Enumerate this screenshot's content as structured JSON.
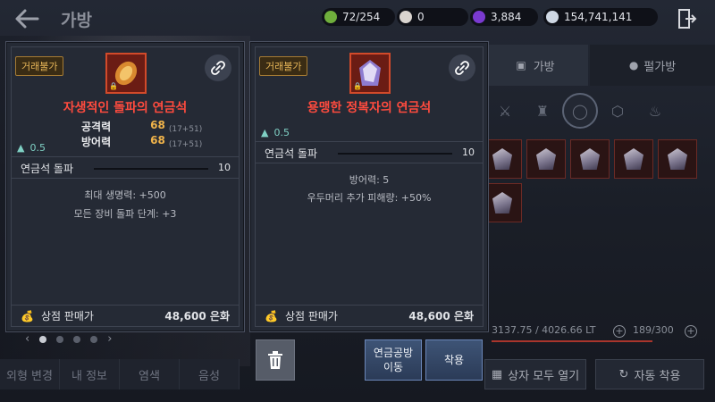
{
  "header": {
    "title": "가방",
    "currencies": [
      {
        "icon": "green-token-icon",
        "value": "72/254",
        "color": "#7fbf4a"
      },
      {
        "icon": "pearl-icon",
        "value": "0",
        "color": "#d9d4cf"
      },
      {
        "icon": "purple-crystal-icon",
        "value": "3,884",
        "color": "#8b4ad8"
      },
      {
        "icon": "silver-coin-icon",
        "value": "154,741,141",
        "color": "#cfd8e4"
      }
    ]
  },
  "bag": {
    "tabs": [
      {
        "label": "가방"
      },
      {
        "label": "펄가방"
      }
    ],
    "filters": [
      "crossed-swords-icon",
      "armor-icon",
      "ring-icon",
      "crystal-icon",
      "potion-icon"
    ],
    "weight": "3137.75 / 4026.66 LT",
    "weight_fraction": 0.78,
    "slots": "189/300",
    "open_all_label": "상자 모두 열기",
    "auto_equip_label": "자동 착용"
  },
  "left_menu": {
    "tabs": [
      "외형 변경",
      "내 정보",
      "염색",
      "음성"
    ],
    "pager_prev": "‹",
    "pager_next": "›",
    "page_count": 4,
    "active_page": 0
  },
  "tooltips": [
    {
      "trade_badge": "거래불가",
      "name": "자생적인 돌파의 연금석",
      "icon_color": "#c8422a",
      "stats": [
        {
          "label": "공격력",
          "value": "68",
          "detail": "(17+51)"
        },
        {
          "label": "방어력",
          "value": "68",
          "detail": "(17+51)"
        }
      ],
      "weight": "0.5",
      "break_label": "연금석 돌파",
      "break_value": "10",
      "effects": [
        "최대 생명력: +500",
        "모든 장비 돌파 단계: +3"
      ],
      "sell_label": "상점 판매가",
      "sell_price": "48,600 은화"
    },
    {
      "trade_badge": "거래불가",
      "name": "용맹한 정복자의 연금석",
      "icon_color": "#c8422a",
      "weight": "0.5",
      "break_label": "연금석 돌파",
      "break_value": "10",
      "effects": [
        "방어력: 5",
        "우두머리 추가 피해량: +50%"
      ],
      "sell_label": "상점 판매가",
      "sell_price": "48,600 은화"
    }
  ],
  "actions": {
    "alchemy_move": "연금공방\n이동",
    "equip": "착용"
  }
}
